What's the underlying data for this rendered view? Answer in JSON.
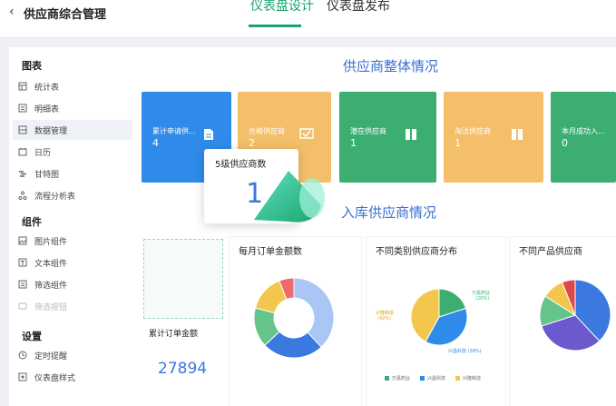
{
  "header": {
    "back_icon": "chevron-left-icon",
    "title": "供应商综合管理",
    "tabs": [
      {
        "label": "仪表盘设计",
        "active": true
      },
      {
        "label": "仪表盘发布",
        "active": false
      }
    ]
  },
  "sidebar": {
    "sections": [
      {
        "title": "图表",
        "items": [
          {
            "label": "统计表",
            "icon": "table-icon"
          },
          {
            "label": "明细表",
            "icon": "list-icon"
          },
          {
            "label": "数据管理",
            "icon": "data-icon",
            "active": true
          },
          {
            "label": "日历",
            "icon": "calendar-icon"
          },
          {
            "label": "甘特图",
            "icon": "gantt-icon"
          },
          {
            "label": "流程分析表",
            "icon": "flow-icon"
          }
        ]
      },
      {
        "title": "组件",
        "items": [
          {
            "label": "图片组件",
            "icon": "image-icon"
          },
          {
            "label": "文本组件",
            "icon": "text-icon"
          },
          {
            "label": "筛选组件",
            "icon": "filter-icon"
          },
          {
            "label": "筛选按钮",
            "icon": "filter-button-icon",
            "disabled": true
          }
        ]
      },
      {
        "title": "设置",
        "items": [
          {
            "label": "定时提醒",
            "icon": "clock-icon"
          },
          {
            "label": "仪表盘样式",
            "icon": "palette-icon"
          }
        ]
      }
    ]
  },
  "dashboard": {
    "section1_title": "供应商整体情况",
    "section2_title": "入库供应商情况",
    "cards": [
      {
        "label": "累计申请供...",
        "value": "4",
        "color": "#2f8bea",
        "icon": "document-icon"
      },
      {
        "label": "合格供应商",
        "value": "2",
        "color": "#f4bf6a",
        "icon": "check-icon"
      },
      {
        "label": "潜在供应商",
        "value": "1",
        "color": "#3cae72",
        "icon": "book-icon"
      },
      {
        "label": "淘汰供应商",
        "value": "1",
        "color": "#f4bf6a",
        "icon": "book-icon"
      },
      {
        "label": "本月成功入...",
        "value": "0",
        "color": "#3cae72",
        "icon": "none"
      }
    ],
    "popover": {
      "title": "5级供应商数",
      "value": "1"
    },
    "total_orders": {
      "title": "累计订单金额",
      "value": "27894"
    },
    "panels": [
      {
        "title": "每月订单金额数"
      },
      {
        "title": "不同类别供应商分布"
      },
      {
        "title": "不同产品供应商"
      }
    ]
  },
  "chart_data": [
    {
      "type": "pie",
      "title": "每月订单金额数",
      "donut": true,
      "labels": [
        "",
        "",
        "",
        "",
        ""
      ],
      "values": [
        38,
        25,
        16,
        15,
        6
      ],
      "colors": [
        "#a9c6f5",
        "#3b78e0",
        "#64c48a",
        "#f3c64d",
        "#ef6b6b"
      ]
    },
    {
      "type": "pie",
      "title": "不同类别供应商分布",
      "labels": [
        "万嘉药业",
        "兴昌科技",
        "兴隆制造"
      ],
      "values": [
        20,
        38,
        42
      ],
      "slice_labels": [
        "万嘉药业\n(20%)",
        "兴昌科技 (38%)",
        "兴隆制造\n(42%)"
      ],
      "colors": [
        "#3cae72",
        "#2f8bea",
        "#f3c64d"
      ],
      "legend": "bottom"
    },
    {
      "type": "pie",
      "title": "不同产品供应商",
      "labels": [
        "",
        "",
        "",
        "",
        ""
      ],
      "values": [
        38,
        32,
        14,
        10,
        6
      ],
      "colors": [
        "#3b78e0",
        "#6a5acd",
        "#64c48a",
        "#f3c64d",
        "#e04848"
      ]
    }
  ]
}
